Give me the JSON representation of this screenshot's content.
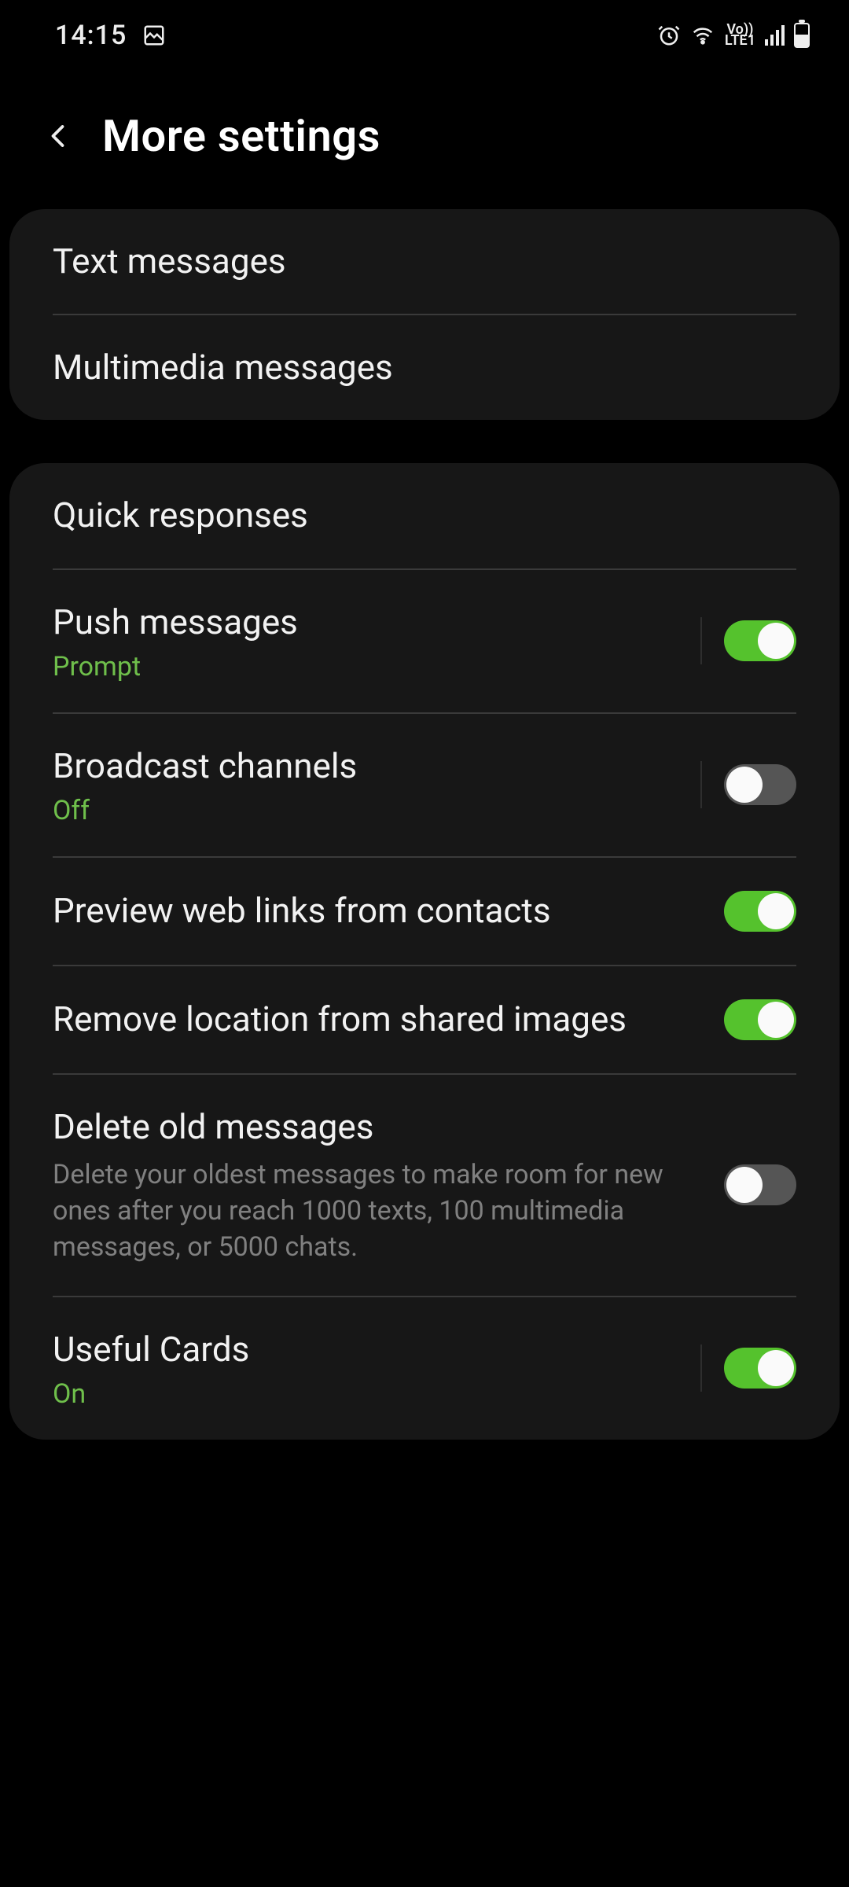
{
  "status": {
    "time": "14:15",
    "volte": "Vo))",
    "lte": "LTE1"
  },
  "header": {
    "title": "More settings"
  },
  "group1": {
    "text_messages": "Text messages",
    "multimedia_messages": "Multimedia messages"
  },
  "group2": {
    "quick_responses": "Quick responses",
    "push_messages": {
      "title": "Push messages",
      "sub": "Prompt",
      "on": true
    },
    "broadcast_channels": {
      "title": "Broadcast channels",
      "sub": "Off",
      "on": false
    },
    "preview_web_links": {
      "title": "Preview web links from contacts",
      "on": true
    },
    "remove_location": {
      "title": "Remove location from shared images",
      "on": true
    },
    "delete_old": {
      "title": "Delete old messages",
      "sub": "Delete your oldest messages to make room for new ones after you reach 1000 texts, 100 multimedia messages, or 5000 chats.",
      "on": false
    },
    "useful_cards": {
      "title": "Useful Cards",
      "sub": "On",
      "on": true
    }
  }
}
